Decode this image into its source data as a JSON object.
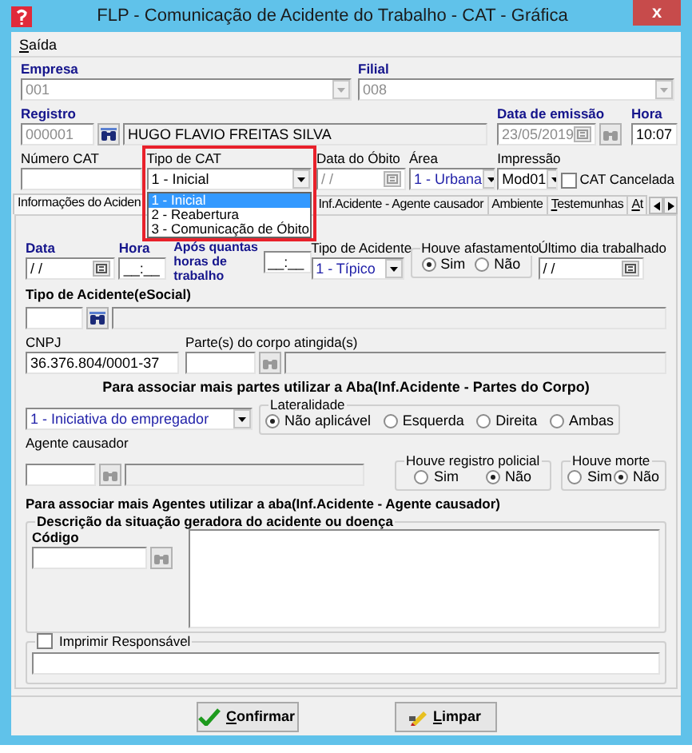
{
  "window": {
    "title": "FLP - Comunicação de Acidente do Trabalho - CAT - Gráfica",
    "close": "x"
  },
  "menu": [
    {
      "label": "Saída",
      "mnemonic": true
    }
  ],
  "header": {
    "empresa": {
      "label": "Empresa",
      "value": "001",
      "disabled": true
    },
    "filial": {
      "label": "Filial",
      "value": "008",
      "disabled": true
    },
    "registro": {
      "label": "Registro",
      "value": "000001",
      "disabled": true,
      "name": "HUGO FLAVIO FREITAS SILVA"
    },
    "data_emissao": {
      "label": "Data de emissão",
      "value": "23/05/2019",
      "disabled": true
    },
    "hora": {
      "label": "Hora",
      "value": "10:07"
    },
    "numero_cat": {
      "label": "Número CAT"
    },
    "tipo_cat": {
      "label": "Tipo de CAT",
      "value": "1 - Inicial",
      "expanded": true,
      "highlighted": true,
      "options": [
        {
          "label": "1 - Inicial",
          "selected": true
        },
        {
          "label": "2 - Reabertura",
          "selected": false
        },
        {
          "label": "3 - Comunicação de Óbito",
          "selected": false
        }
      ]
    },
    "data_obito": {
      "label": "Data do Óbito",
      "value": "/ /"
    },
    "area": {
      "label": "Área",
      "value": "1 - Urbana"
    },
    "impressao": {
      "label": "Impressão",
      "value": "Mod01"
    },
    "cat_cancelada": {
      "label": "CAT Cancelada",
      "checked": false
    }
  },
  "tabs": [
    {
      "label": "Informações do Aciden",
      "selected": true,
      "mnemonic": false
    },
    {
      "label": "Inf.Acidente - Agente causador",
      "selected": false,
      "mnemonic": false
    },
    {
      "label": "Ambiente",
      "selected": false,
      "mnemonic": false
    },
    {
      "label": "Testemunhas",
      "selected": false,
      "mnemonic": true
    },
    {
      "label": "At",
      "selected": false,
      "mnemonic": true
    }
  ],
  "accident": {
    "data": {
      "label": "Data",
      "value": "/ /"
    },
    "hora": {
      "label": "Hora",
      "value": "__:__"
    },
    "apos": {
      "label": "Após quantas horas de trabalho",
      "value": "__:__"
    },
    "tipo": {
      "label": "Tipo de Acidente",
      "value": "1 - Típico"
    },
    "afastamento": {
      "label": "Houve afastamento",
      "options": [
        {
          "label": "Sim",
          "selected": true
        },
        {
          "label": "Não",
          "selected": false
        }
      ]
    },
    "ultimo_dia": {
      "label": "Último dia trabalhado",
      "value": "/ /"
    },
    "tipo_esocial": {
      "label": "Tipo de Acidente(eSocial)"
    },
    "cnpj": {
      "label": "CNPJ",
      "value": "36.376.804/0001-37"
    },
    "partes": {
      "label": "Parte(s) do corpo atingida(s)"
    },
    "note_partes": "Para associar mais partes utilizar a Aba(Inf.Acidente - Partes do Corpo)",
    "iniciativa": {
      "value": "1 - Iniciativa do empregador"
    },
    "lateralidade": {
      "label": "Lateralidade",
      "options": [
        {
          "label": "Não aplicável",
          "selected": true
        },
        {
          "label": "Esquerda",
          "selected": false
        },
        {
          "label": "Direita",
          "selected": false
        },
        {
          "label": "Ambas",
          "selected": false
        }
      ]
    },
    "agente": {
      "label": "Agente causador"
    },
    "registro_policial": {
      "label": "Houve registro policial",
      "options": [
        {
          "label": "Sim",
          "selected": false
        },
        {
          "label": "Não",
          "selected": true
        }
      ]
    },
    "morte": {
      "label": "Houve morte",
      "options": [
        {
          "label": "Sim",
          "selected": false
        },
        {
          "label": "Não",
          "selected": true
        }
      ]
    },
    "note_agentes": "Para associar mais Agentes utilizar a aba(Inf.Acidente - Agente causador)",
    "descricao": {
      "label": "Descrição da situação geradora do acidente ou doença",
      "codigo_label": "Código"
    },
    "imprimir": {
      "label": "Imprimir Responsável",
      "checked": false
    }
  },
  "buttons": [
    {
      "label": "Confirmar",
      "kind": "confirm",
      "mnemonic": true
    },
    {
      "label": "Limpar",
      "kind": "clear",
      "mnemonic": true
    }
  ]
}
